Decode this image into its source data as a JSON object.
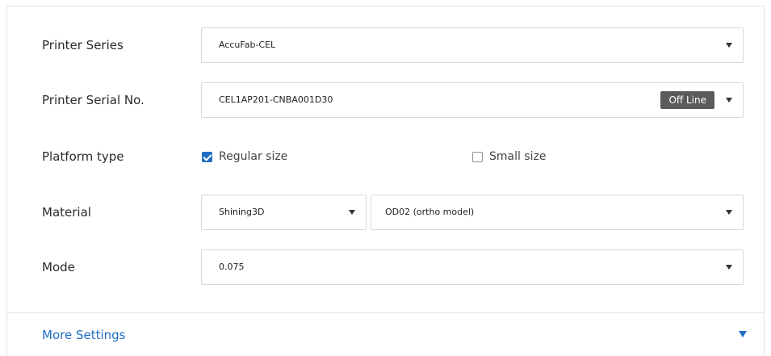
{
  "fields": {
    "printer_series": {
      "label": "Printer Series",
      "value": "AccuFab-CEL"
    },
    "printer_serial": {
      "label": "Printer Serial No.",
      "value": "CEL1AP201-CNBA001D30",
      "status_badge": "Off Line"
    },
    "platform_type": {
      "label": "Platform type",
      "options": [
        {
          "label": "Regular size",
          "checked": true
        },
        {
          "label": "Small size",
          "checked": false
        }
      ]
    },
    "material": {
      "label": "Material",
      "brand": "Shining3D",
      "type": "OD02 (ortho model)"
    },
    "mode": {
      "label": "Mode",
      "value": "0.075"
    }
  },
  "more_settings": {
    "label": "More Settings"
  },
  "colors": {
    "accent": "#1f6dc4",
    "badge_bg": "#5b5b5b",
    "border": "#d9d9d9"
  }
}
